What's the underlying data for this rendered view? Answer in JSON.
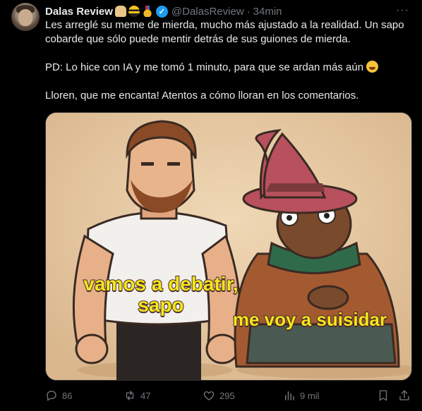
{
  "author": {
    "name": "Dalas Review",
    "handle": "@DalasReview",
    "time": "34min",
    "badges": [
      "bread-emoji",
      "bee-emoji",
      "medal-emoji"
    ],
    "verified": true
  },
  "tweet": {
    "line1": "Les arreglé su meme de mierda, mucho más ajustado a la realidad. Un sapo cobarde que sólo puede mentir detrás de sus guiones de mierda.",
    "line2": "PD: Lo hice con IA y me tomó 1 minuto, para que se ardan más aún ",
    "line3": "Lloren, que me encanta! Atentos a cómo lloran en los comentarios."
  },
  "meme": {
    "caption_left": "vamos a debatir, sapo",
    "caption_right": "me voy a suisidar"
  },
  "actions": {
    "replies": "86",
    "reposts": "47",
    "likes": "295",
    "views": "9 mil"
  },
  "colors": {
    "accent": "#1d9bf0",
    "muted": "#71767b",
    "text": "#e7e9ea",
    "background": "#000000"
  }
}
